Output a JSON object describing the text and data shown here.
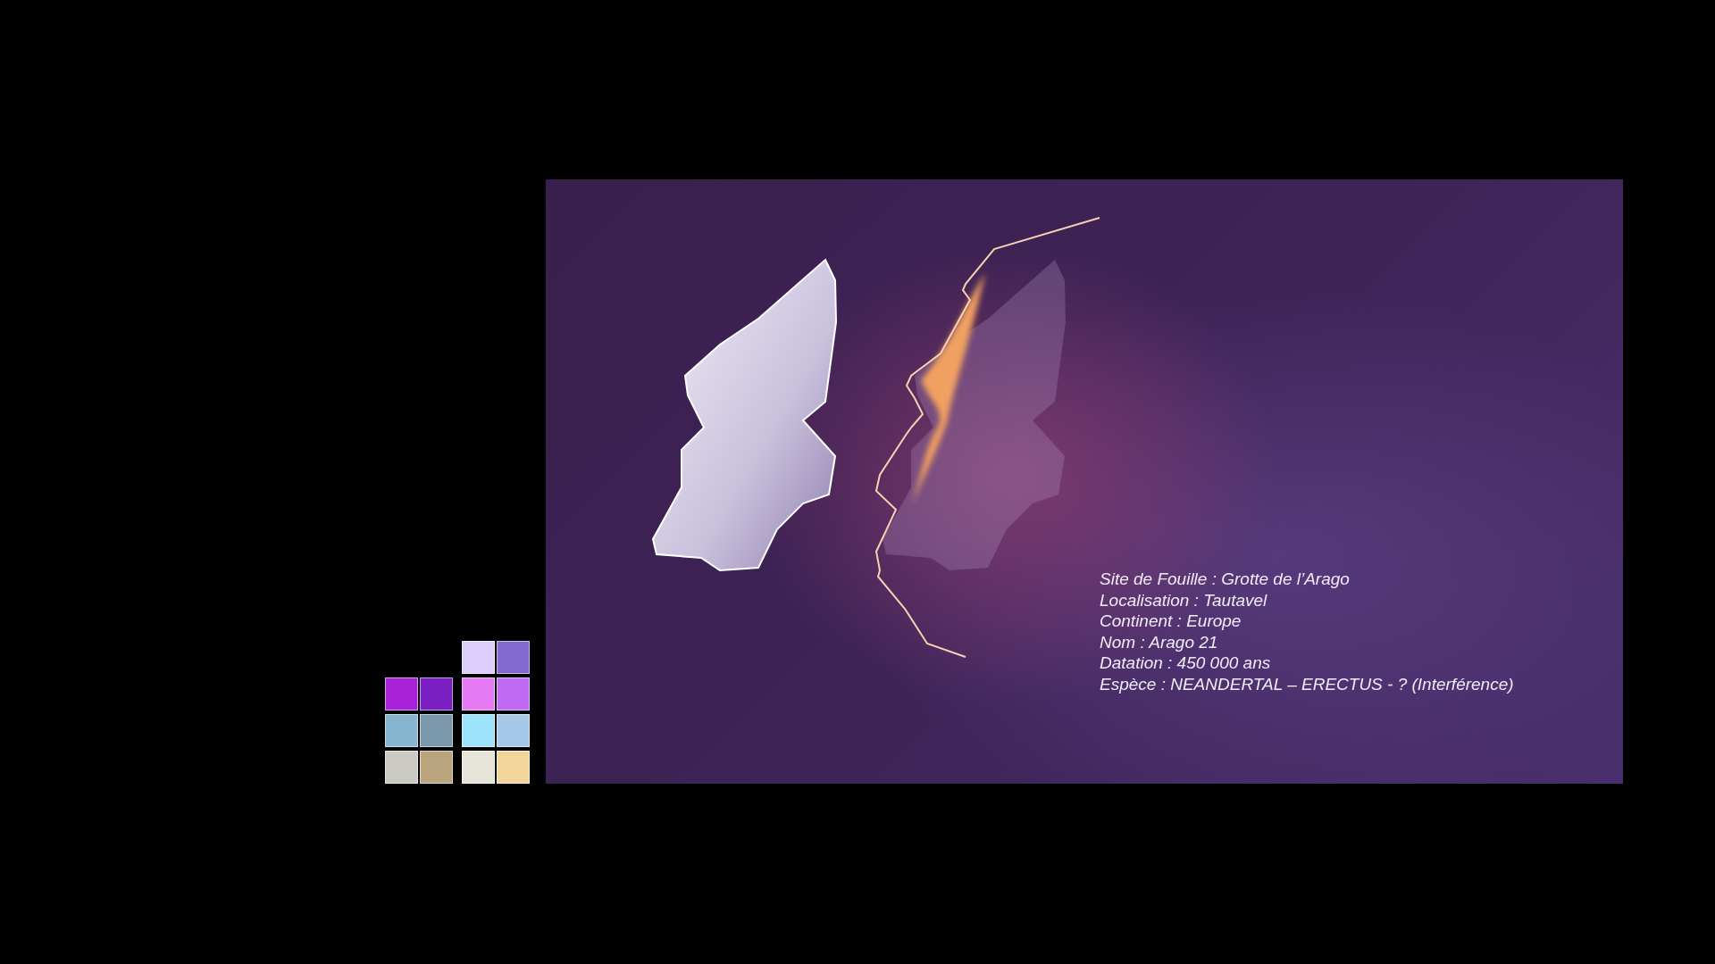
{
  "palette": {
    "groups": [
      {
        "swatches": [
          {
            "color": "#a823d8"
          },
          {
            "color": "#7a1fc2"
          },
          {
            "color": "#85b5cf"
          },
          {
            "color": "#7a97ac"
          },
          {
            "color": "#cbcac2"
          },
          {
            "color": "#b9a47e"
          }
        ]
      },
      {
        "swatches": [
          {
            "color": "#dccdfb"
          },
          {
            "color": "#8069cf"
          },
          {
            "color": "#e67af5"
          },
          {
            "color": "#c06bf3"
          },
          {
            "color": "#9de3fc"
          },
          {
            "color": "#a5c8e8"
          },
          {
            "color": "#e6e4d8"
          },
          {
            "color": "#f2d59b"
          }
        ]
      }
    ]
  },
  "artwork": {
    "info_lines": [
      "Site de Fouille : Grotte de l’Arago",
      "Localisation : Tautavel",
      "Continent : Europe",
      "Nom : Arago 21",
      "Datation : 450 000 ans",
      "Espèce : NEANDERTAL – ERECTUS - ? (Interférence)"
    ]
  }
}
